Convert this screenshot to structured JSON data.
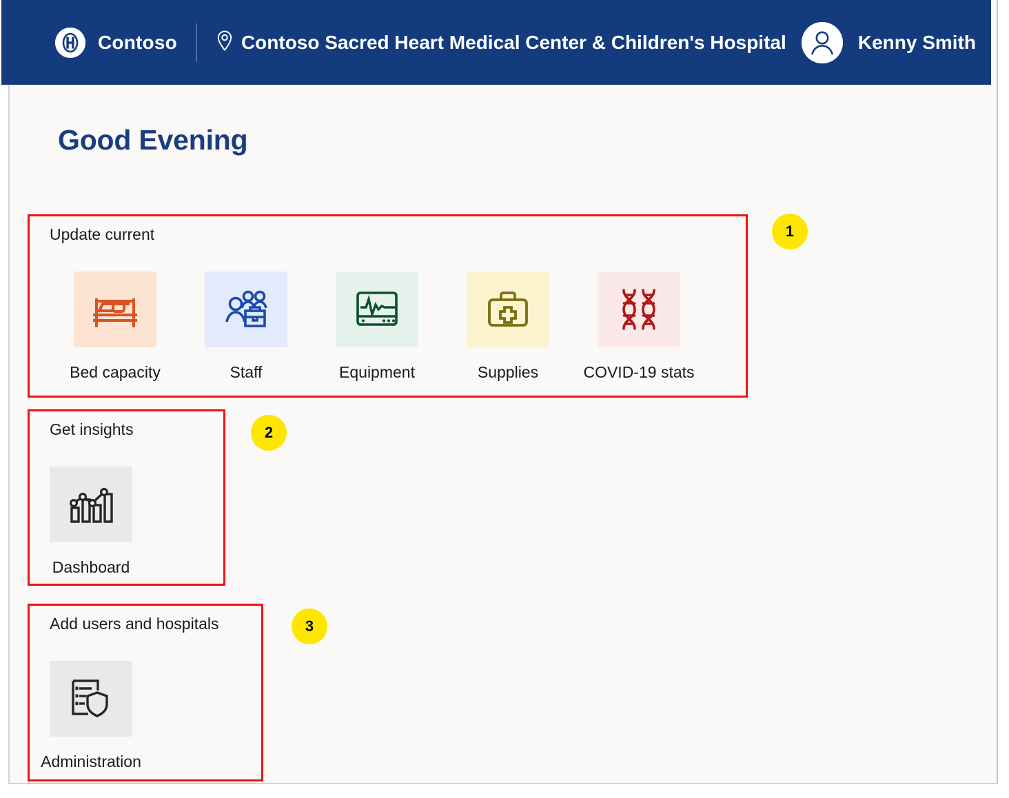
{
  "header": {
    "logo_icon": "hospital-h-logo-icon",
    "brand": "Contoso",
    "location_icon": "map-pin-icon",
    "facility": "Contoso Sacred Heart Medical Center & Children's Hospital",
    "avatar_icon": "user-avatar-icon",
    "user": "Kenny Smith",
    "background_color": "#133b7d"
  },
  "page": {
    "greeting": "Good Evening",
    "greeting_color": "#1b3d80",
    "background_color": "#faf9f7",
    "annotation_color": "#ee1111"
  },
  "sections": [
    {
      "title": "Update current",
      "callout": "1",
      "tiles": [
        {
          "label": "Bed capacity",
          "icon": "hospital-bed-icon",
          "icon_color": "#d9531e",
          "tile_bg": "#fce3d2"
        },
        {
          "label": "Staff",
          "icon": "staff-people-icon",
          "icon_color": "#1a4aad",
          "tile_bg": "#e2eafb"
        },
        {
          "label": "Equipment",
          "icon": "vitals-monitor-icon",
          "icon_color": "#0b5132",
          "tile_bg": "#e6f2ec"
        },
        {
          "label": "Supplies",
          "icon": "medical-bag-icon",
          "icon_color": "#7c6f10",
          "tile_bg": "#fcf3cf"
        },
        {
          "label": "COVID-19 stats",
          "icon": "dna-helix-icon",
          "icon_color": "#b31616",
          "tile_bg": "#fbe9e9"
        }
      ]
    },
    {
      "title": "Get insights",
      "callout": "2",
      "tiles": [
        {
          "label": "Dashboard",
          "icon": "bar-chart-trend-icon",
          "icon_color": "#262626",
          "tile_bg": "#e9e9e9"
        }
      ]
    },
    {
      "title": "Add users and hospitals",
      "callout": "3",
      "tiles": [
        {
          "label": "Administration",
          "icon": "document-shield-icon",
          "icon_color": "#262626",
          "tile_bg": "#e9e9e9"
        }
      ]
    }
  ]
}
